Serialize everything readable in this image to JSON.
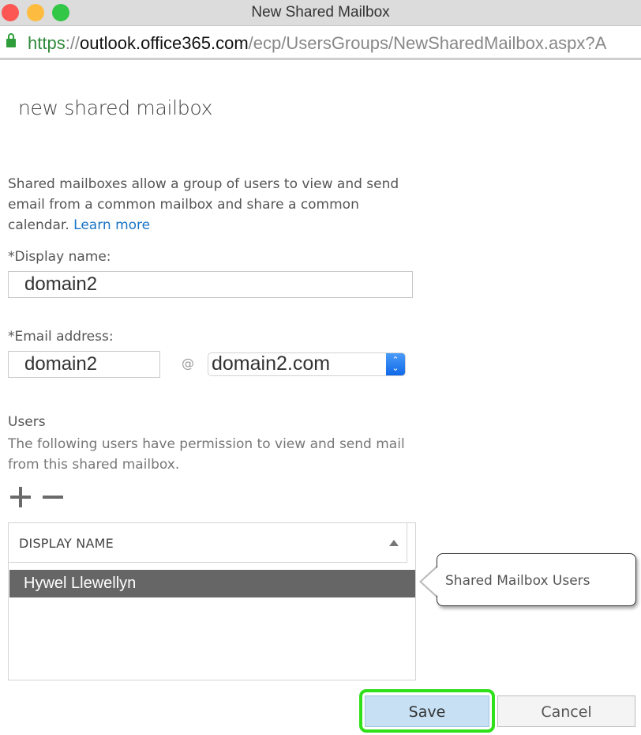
{
  "window": {
    "title": "New Shared Mailbox"
  },
  "address_bar": {
    "scheme": "https",
    "separator": "://",
    "host": "outlook.office365.com",
    "path": "/ecp/UsersGroups/NewSharedMailbox.aspx?A"
  },
  "form": {
    "title": "new shared mailbox",
    "intro_text": "Shared mailboxes allow a group of users to view and send email from a common mailbox and share a common calendar.",
    "learn_more_label": "Learn more",
    "display_name_label": "*Display name:",
    "display_name_value": "domain2",
    "email_label": "*Email address:",
    "email_alias_value": "domain2",
    "at_symbol": "@",
    "domain_selected": "domain2.com",
    "users_title": "Users",
    "users_description": "The following users have permission to view and send mail from this shared mailbox.",
    "add_icon": "plus-icon",
    "remove_icon": "minus-icon"
  },
  "users_grid": {
    "columns": [
      "DISPLAY NAME"
    ],
    "sort": "ascending",
    "rows": [
      {
        "display_name": "Hywel Llewellyn",
        "selected": true
      }
    ]
  },
  "callout": {
    "text": "Shared Mailbox Users"
  },
  "footer": {
    "save_label": "Save",
    "cancel_label": "Cancel",
    "highlight_color": "#2fe01a"
  }
}
